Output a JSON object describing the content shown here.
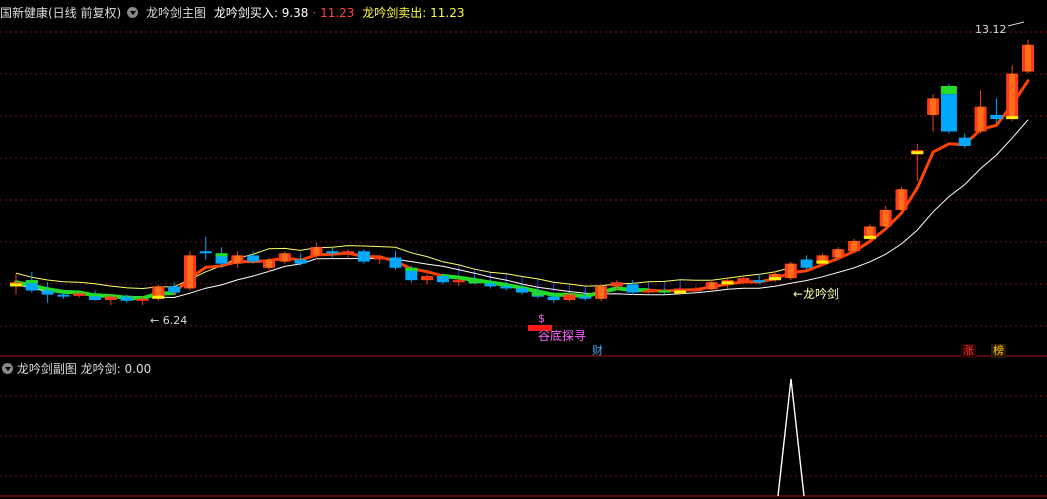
{
  "header": {
    "stock_name": "国新健康(日线 前复权)",
    "main_indicator": "龙吟剑主图",
    "buy_label": "龙吟剑买入: 9.38",
    "buy_extra": "· 11.23",
    "sell_label": "龙吟剑卖出: 11.23"
  },
  "sub_header": {
    "indicator": "龙吟剑副图",
    "value_label": "龙吟剑: 0.00"
  },
  "annotations": {
    "low_price": "← 6.24",
    "high_price": "13.12",
    "signal_text": "谷底探寻",
    "dollar": "$",
    "longyin_label": "←龙吟剑",
    "badge_cai": "财",
    "badge_zhang": "涨",
    "badge_bang": "榜"
  },
  "colors": {
    "up": "#ff3b1a",
    "down": "#00a8ff",
    "highlight_green": "#22dd22",
    "highlight_yellow": "#ffee00",
    "ma_line": "#ffffff",
    "trend_line": "#ff4400",
    "band_line": "#ffff66",
    "fill_blue": "#2244ff",
    "grid": "#7a1010",
    "signal_pink": "#ff66ff"
  },
  "chart_data": {
    "type": "candlestick",
    "title": "龙吟剑主图",
    "ylim": [
      5.0,
      14.0
    ],
    "candles": [
      {
        "o": 7.15,
        "h": 7.45,
        "l": 6.95,
        "c": 7.25,
        "t": "up"
      },
      {
        "o": 7.3,
        "h": 7.5,
        "l": 7.0,
        "c": 7.05,
        "t": "dn"
      },
      {
        "o": 7.05,
        "h": 7.25,
        "l": 6.75,
        "c": 6.95,
        "t": "dn"
      },
      {
        "o": 6.95,
        "h": 7.0,
        "l": 6.85,
        "c": 6.92,
        "t": "dn"
      },
      {
        "o": 6.92,
        "h": 7.0,
        "l": 6.88,
        "c": 6.98,
        "t": "up"
      },
      {
        "o": 6.98,
        "h": 7.05,
        "l": 6.8,
        "c": 6.82,
        "t": "dn"
      },
      {
        "o": 6.82,
        "h": 6.95,
        "l": 6.7,
        "c": 6.9,
        "t": "up"
      },
      {
        "o": 6.9,
        "h": 6.95,
        "l": 6.75,
        "c": 6.8,
        "t": "dn"
      },
      {
        "o": 6.8,
        "h": 6.9,
        "l": 6.7,
        "c": 6.85,
        "t": "up"
      },
      {
        "o": 6.85,
        "h": 7.2,
        "l": 6.8,
        "c": 7.15,
        "t": "up"
      },
      {
        "o": 7.15,
        "h": 7.25,
        "l": 6.95,
        "c": 7.0,
        "t": "dn"
      },
      {
        "o": 7.1,
        "h": 8.0,
        "l": 7.05,
        "c": 7.9,
        "t": "up"
      },
      {
        "o": 7.95,
        "h": 8.35,
        "l": 7.8,
        "c": 8.0,
        "t": "dn"
      },
      {
        "o": 7.95,
        "h": 8.1,
        "l": 7.6,
        "c": 7.7,
        "t": "dn"
      },
      {
        "o": 7.7,
        "h": 8.0,
        "l": 7.6,
        "c": 7.9,
        "t": "up"
      },
      {
        "o": 7.9,
        "h": 8.0,
        "l": 7.7,
        "c": 7.75,
        "t": "dn"
      },
      {
        "o": 7.6,
        "h": 7.85,
        "l": 7.5,
        "c": 7.8,
        "t": "up"
      },
      {
        "o": 7.75,
        "h": 8.0,
        "l": 7.7,
        "c": 7.95,
        "t": "up"
      },
      {
        "o": 7.8,
        "h": 7.95,
        "l": 7.65,
        "c": 7.7,
        "t": "dn"
      },
      {
        "o": 7.9,
        "h": 8.2,
        "l": 7.8,
        "c": 8.1,
        "t": "up"
      },
      {
        "o": 8.0,
        "h": 8.1,
        "l": 7.85,
        "c": 7.95,
        "t": "dn"
      },
      {
        "o": 7.95,
        "h": 8.05,
        "l": 7.85,
        "c": 8.0,
        "t": "up"
      },
      {
        "o": 8.0,
        "h": 8.05,
        "l": 7.7,
        "c": 7.75,
        "t": "dn"
      },
      {
        "o": 7.8,
        "h": 7.9,
        "l": 7.7,
        "c": 7.85,
        "t": "up"
      },
      {
        "o": 7.85,
        "h": 8.0,
        "l": 7.55,
        "c": 7.6,
        "t": "dn"
      },
      {
        "o": 7.6,
        "h": 7.65,
        "l": 7.25,
        "c": 7.3,
        "t": "dn"
      },
      {
        "o": 7.3,
        "h": 7.45,
        "l": 7.2,
        "c": 7.4,
        "t": "up"
      },
      {
        "o": 7.4,
        "h": 7.45,
        "l": 7.2,
        "c": 7.25,
        "t": "dn"
      },
      {
        "o": 7.25,
        "h": 7.35,
        "l": 7.15,
        "c": 7.3,
        "t": "up"
      },
      {
        "o": 7.3,
        "h": 7.4,
        "l": 7.2,
        "c": 7.22,
        "t": "dn"
      },
      {
        "o": 7.22,
        "h": 7.3,
        "l": 7.1,
        "c": 7.15,
        "t": "dn"
      },
      {
        "o": 7.15,
        "h": 7.25,
        "l": 7.05,
        "c": 7.1,
        "t": "dn"
      },
      {
        "o": 7.1,
        "h": 7.2,
        "l": 6.95,
        "c": 7.0,
        "t": "dn"
      },
      {
        "o": 7.0,
        "h": 7.1,
        "l": 6.85,
        "c": 6.9,
        "t": "dn"
      },
      {
        "o": 6.9,
        "h": 6.95,
        "l": 6.75,
        "c": 6.82,
        "t": "dn"
      },
      {
        "o": 6.82,
        "h": 7.0,
        "l": 6.78,
        "c": 6.95,
        "t": "up"
      },
      {
        "o": 6.9,
        "h": 7.05,
        "l": 6.8,
        "c": 6.85,
        "t": "dn"
      },
      {
        "o": 6.85,
        "h": 7.2,
        "l": 6.8,
        "c": 7.15,
        "t": "up"
      },
      {
        "o": 7.15,
        "h": 7.3,
        "l": 7.05,
        "c": 7.25,
        "t": "up"
      },
      {
        "o": 7.2,
        "h": 7.3,
        "l": 6.95,
        "c": 7.0,
        "t": "dn"
      },
      {
        "o": 7.0,
        "h": 7.1,
        "l": 6.98,
        "c": 7.05,
        "t": "up"
      },
      {
        "o": 7.05,
        "h": 7.1,
        "l": 6.95,
        "c": 7.0,
        "t": "dn"
      },
      {
        "o": 6.98,
        "h": 7.15,
        "l": 6.95,
        "c": 7.1,
        "t": "up"
      },
      {
        "o": 7.05,
        "h": 7.15,
        "l": 7.0,
        "c": 7.08,
        "t": "up"
      },
      {
        "o": 7.08,
        "h": 7.3,
        "l": 7.02,
        "c": 7.25,
        "t": "up"
      },
      {
        "o": 7.2,
        "h": 7.35,
        "l": 7.1,
        "c": 7.3,
        "t": "up"
      },
      {
        "o": 7.25,
        "h": 7.4,
        "l": 7.2,
        "c": 7.35,
        "t": "up"
      },
      {
        "o": 7.3,
        "h": 7.45,
        "l": 7.2,
        "c": 7.25,
        "t": "dn"
      },
      {
        "o": 7.3,
        "h": 7.5,
        "l": 7.25,
        "c": 7.45,
        "t": "up"
      },
      {
        "o": 7.35,
        "h": 7.75,
        "l": 7.3,
        "c": 7.7,
        "t": "up"
      },
      {
        "o": 7.8,
        "h": 7.9,
        "l": 7.55,
        "c": 7.6,
        "t": "dn"
      },
      {
        "o": 7.7,
        "h": 7.95,
        "l": 7.65,
        "c": 7.9,
        "t": "up"
      },
      {
        "o": 7.85,
        "h": 8.1,
        "l": 7.8,
        "c": 8.05,
        "t": "up"
      },
      {
        "o": 8.0,
        "h": 8.3,
        "l": 7.95,
        "c": 8.25,
        "t": "up"
      },
      {
        "o": 8.3,
        "h": 8.65,
        "l": 8.25,
        "c": 8.6,
        "t": "up"
      },
      {
        "o": 8.6,
        "h": 9.1,
        "l": 8.55,
        "c": 9.0,
        "t": "up"
      },
      {
        "o": 9.0,
        "h": 9.55,
        "l": 8.95,
        "c": 9.5,
        "t": "up"
      },
      {
        "o": 10.35,
        "h": 10.6,
        "l": 9.7,
        "c": 10.45,
        "t": "flat"
      },
      {
        "o": 11.3,
        "h": 11.8,
        "l": 10.9,
        "c": 11.7,
        "t": "up"
      },
      {
        "o": 12.0,
        "h": 12.05,
        "l": 10.85,
        "c": 10.9,
        "t": "big"
      },
      {
        "o": 10.75,
        "h": 10.85,
        "l": 10.5,
        "c": 10.55,
        "t": "dn"
      },
      {
        "o": 10.9,
        "h": 11.9,
        "l": 10.85,
        "c": 11.5,
        "t": "up"
      },
      {
        "o": 11.3,
        "h": 11.7,
        "l": 11.1,
        "c": 11.2,
        "t": "dn"
      },
      {
        "o": 11.2,
        "h": 12.5,
        "l": 11.15,
        "c": 12.3,
        "t": "up"
      },
      {
        "o": 12.35,
        "h": 13.12,
        "l": 12.3,
        "c": 13.0,
        "t": "up"
      }
    ]
  }
}
